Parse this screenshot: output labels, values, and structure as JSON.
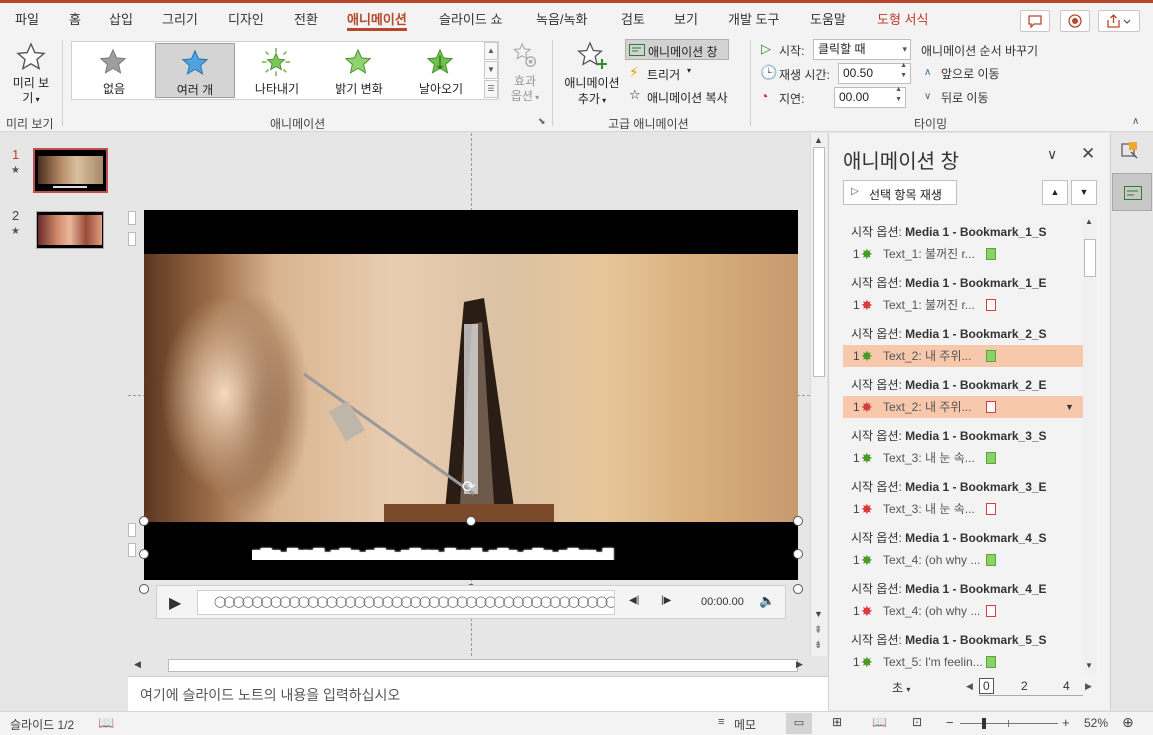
{
  "tabs": [
    "파일",
    "홈",
    "삽입",
    "그리기",
    "디자인",
    "전환",
    "애니메이션",
    "슬라이드 쇼",
    "녹음/녹화",
    "검토",
    "보기",
    "개발 도구",
    "도움말",
    "도형 서식"
  ],
  "ribbon": {
    "preview": {
      "label_line1": "미리 보",
      "label_line2": "기",
      "group": "미리 보기"
    },
    "gallery": {
      "items": [
        "없음",
        "여러 개",
        "나타내기",
        "밝기 변화",
        "날아오기"
      ],
      "selected": "여러 개",
      "effect_options_line1": "효과",
      "effect_options_line2": "옵션",
      "group": "애니메이션"
    },
    "advanced": {
      "add_line1": "애니메이션",
      "add_line2": "추가",
      "pane_btn": "애니메이션 창",
      "trigger": "트리거",
      "painter": "애니메이션 복사",
      "group": "고급 애니메이션"
    },
    "timing": {
      "start_label": "시작:",
      "start_value": "클릭할 때",
      "duration_label": "재생 시간:",
      "duration_value": "00.50",
      "delay_label": "지연:",
      "delay_value": "00.00",
      "reorder": "애니메이션 순서 바꾸기",
      "move_earlier": "앞으로 이동",
      "move_later": "뒤로 이동",
      "group": "타이밍"
    }
  },
  "thumbnails": [
    {
      "num": "1",
      "star": "★"
    },
    {
      "num": "2",
      "star": "★"
    }
  ],
  "media": {
    "time": "00:00.00"
  },
  "notes_placeholder": "여기에 슬라이드 노트의 내용을 입력하십시오",
  "anim_pane": {
    "title": "애니메이션 창",
    "play_btn": "선택 항목 재생",
    "entries": [
      {
        "header_prefix": "시작 옵션: ",
        "header": "Media 1 - Bookmark_1_S",
        "num": "1",
        "text": "Text_1: 불꺼진 r...",
        "kind": "start",
        "hl": false
      },
      {
        "header_prefix": "시작 옵션: ",
        "header": "Media 1 - Bookmark_1_E",
        "num": "1",
        "text": "Text_1: 불꺼진 r...",
        "kind": "end",
        "hl": false
      },
      {
        "header_prefix": "시작 옵션: ",
        "header": "Media 1 - Bookmark_2_S",
        "num": "1",
        "text": "Text_2: 내 주위...",
        "kind": "start",
        "hl": true
      },
      {
        "header_prefix": "시작 옵션: ",
        "header": "Media 1 - Bookmark_2_E",
        "num": "1",
        "text": "Text_2: 내 주위...",
        "kind": "end",
        "hl": true
      },
      {
        "header_prefix": "시작 옵션: ",
        "header": "Media 1 - Bookmark_3_S",
        "num": "1",
        "text": "Text_3: 내 눈 속...",
        "kind": "start",
        "hl": false
      },
      {
        "header_prefix": "시작 옵션: ",
        "header": "Media 1 - Bookmark_3_E",
        "num": "1",
        "text": "Text_3: 내 눈 속...",
        "kind": "end",
        "hl": false
      },
      {
        "header_prefix": "시작 옵션: ",
        "header": "Media 1 - Bookmark_4_S",
        "num": "1",
        "text": "Text_4: (oh why ...",
        "kind": "start",
        "hl": false
      },
      {
        "header_prefix": "시작 옵션: ",
        "header": "Media 1 - Bookmark_4_E",
        "num": "1",
        "text": "Text_4: (oh why ...",
        "kind": "end",
        "hl": false
      },
      {
        "header_prefix": "시작 옵션: ",
        "header": "Media 1 - Bookmark_5_S",
        "num": "1",
        "text": "Text_5: I'm feelin...",
        "kind": "start",
        "hl": false
      }
    ],
    "timeline_unit": "초",
    "timeline_ticks": [
      "0",
      "2",
      "4"
    ]
  },
  "status": {
    "slide": "슬라이드 1/2",
    "notes": "메모",
    "zoom": "52%"
  }
}
